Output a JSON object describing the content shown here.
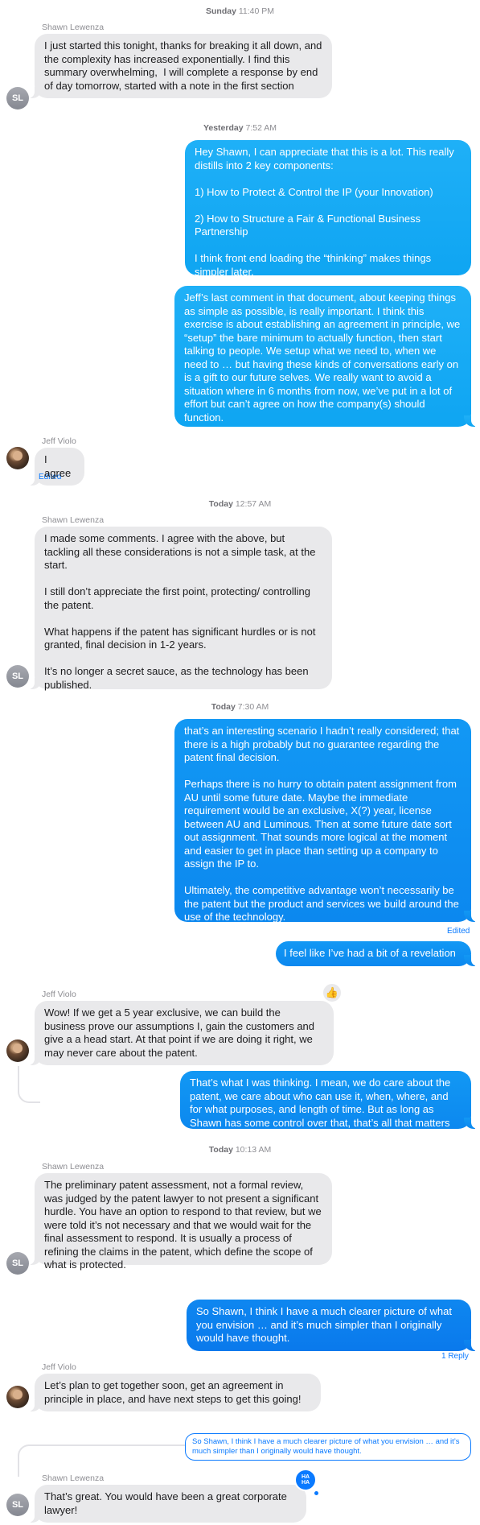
{
  "timestamps": [
    {
      "day": "Sunday",
      "time": "11:40 PM"
    },
    {
      "day": "Yesterday",
      "time": "7:52 AM"
    },
    {
      "day": "Today",
      "time": "12:57 AM"
    },
    {
      "day": "Today",
      "time": "7:30 AM"
    },
    {
      "day": "Today",
      "time": "10:13 AM"
    }
  ],
  "senders": {
    "shawn": {
      "name": "Shawn Lewenza",
      "initials": "SL"
    },
    "jeff": {
      "name": "Jeff Violo"
    }
  },
  "messages": [
    {
      "text": "I just started this tonight, thanks for breaking it all down, and the complexity has increased exponentially. I find this summary overwhelming,  I will complete a response by end of day tomorrow, started with a note in the first section"
    },
    {
      "text": "Hey Shawn, I can appreciate that this is a lot. This really distills into 2 key components:\n\n1) How to Protect & Control the IP (your Innovation)\n\n2) How to Structure a Fair & Functional Business Partnership\n\nI think front end loading the “thinking” makes things simpler later."
    },
    {
      "text": "Jeff’s last comment in that document, about keeping things as simple as possible, is really important. I think this exercise is about establishing an agreement in principle, we “setup” the bare minimum to actually function, then start talking to people. We setup what we need to, when we need to … but having these kinds of conversations early on is a gift to our future selves. We really want to avoid a situation where in 6 months from now, we’ve put in a lot of effort but can’t agree on how the company(s) should function."
    },
    {
      "text": "I agree"
    },
    {
      "text": "I made some comments. I agree with the above, but tackling all these considerations is not a simple task, at the start.\n\nI still don’t appreciate the first point, protecting/ controlling the patent.\n\nWhat happens if the patent has significant hurdles or is not granted, final decision in 1-2 years.\n\nIt’s no longer a secret sauce, as the technology has been published."
    },
    {
      "text": "that’s an interesting scenario I hadn’t really considered; that there is a high probably but no guarantee regarding the patent final decision.\n\nPerhaps there is no hurry to obtain patent assignment from AU until some future date. Maybe the immediate requirement would be an exclusive, X(?) year, license between AU and Luminous. Then at some future date sort out assignment. That sounds more logical at the moment and easier to get in place than setting up a company to assign the IP to.\n\nUltimately, the competitive advantage won’t necessarily be the patent but the product and services we build around the use of the technology."
    },
    {
      "text": "I feel like I’ve had a bit of a revelation"
    },
    {
      "text": "Wow! If we get a 5 year exclusive, we can build the business prove our assumptions I, gain the customers and give a a head start. At that point if we are doing it right, we may never care about the patent."
    },
    {
      "text": "That’s what I was thinking. I mean, we do care about the patent, we care about who can use it, when, where, and for what purposes, and length of time. But as long as Shawn has some control over that, that’s all that matters"
    },
    {
      "text": "The preliminary patent assessment, not a formal review, was judged by the patent lawyer to not present a significant hurdle. You have an option to respond to that review, but we were told it’s not necessary and that we would wait for the final assessment to respond. It is usually a process of refining the claims in the patent, which define the scope of what is protected."
    },
    {
      "text": "So Shawn, I think I have a much clearer picture of what you envision … and it’s much simpler than I originally would have thought."
    },
    {
      "text": "Let’s plan to get together soon, get an agreement in principle in place, and have next steps to get this going!"
    },
    {
      "text": "So Shawn, I think I have a much clearer picture of what you envision … and it’s much simpler than I originally would have thought."
    },
    {
      "text": "That’s great. You would have been a great corporate lawyer!"
    }
  ],
  "meta": {
    "edited": "Edited",
    "reply_count": "1 Reply",
    "haha_label": "HA\nHA"
  },
  "reactions": {
    "thumbs_up": "👍"
  }
}
